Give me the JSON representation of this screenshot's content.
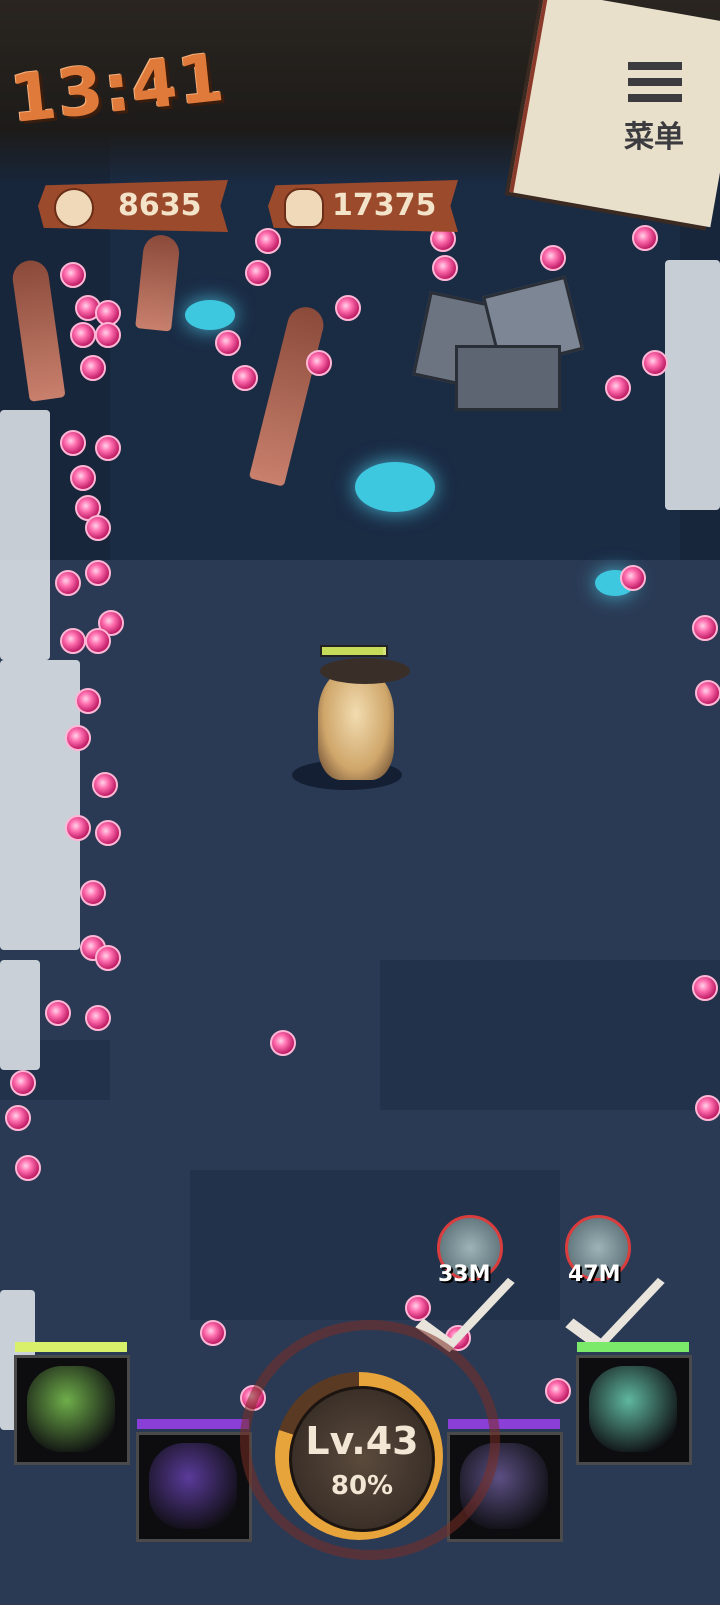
{
  "hud": {
    "clock": "13:41",
    "menu_label": "菜单",
    "coins": "8635",
    "kills": "17375"
  },
  "player": {
    "health_fraction": 0.95
  },
  "enemy_markers": [
    {
      "distance": "33M"
    },
    {
      "distance": "47M"
    }
  ],
  "level": {
    "label": "Lv.43",
    "progress_text": "80%",
    "progress": 0.8
  },
  "skills": [
    {
      "slot": "skill-1",
      "bar_color": "#d8f06a",
      "art_color": "#6fae4a"
    },
    {
      "slot": "skill-2",
      "bar_color": "#8a3fd6",
      "art_color": "#5a3b9a"
    },
    {
      "slot": "skill-3",
      "bar_color": "#8a3fd6",
      "art_color": "#5b4f82"
    },
    {
      "slot": "skill-4",
      "bar_color": "#7bea6a",
      "art_color": "#5fb7a0"
    }
  ],
  "colors": {
    "clock": "#e07a3a",
    "resource_banner": "#9c4a2c",
    "orb": "#ff6fb0",
    "crystal": "#3ec8e0"
  }
}
